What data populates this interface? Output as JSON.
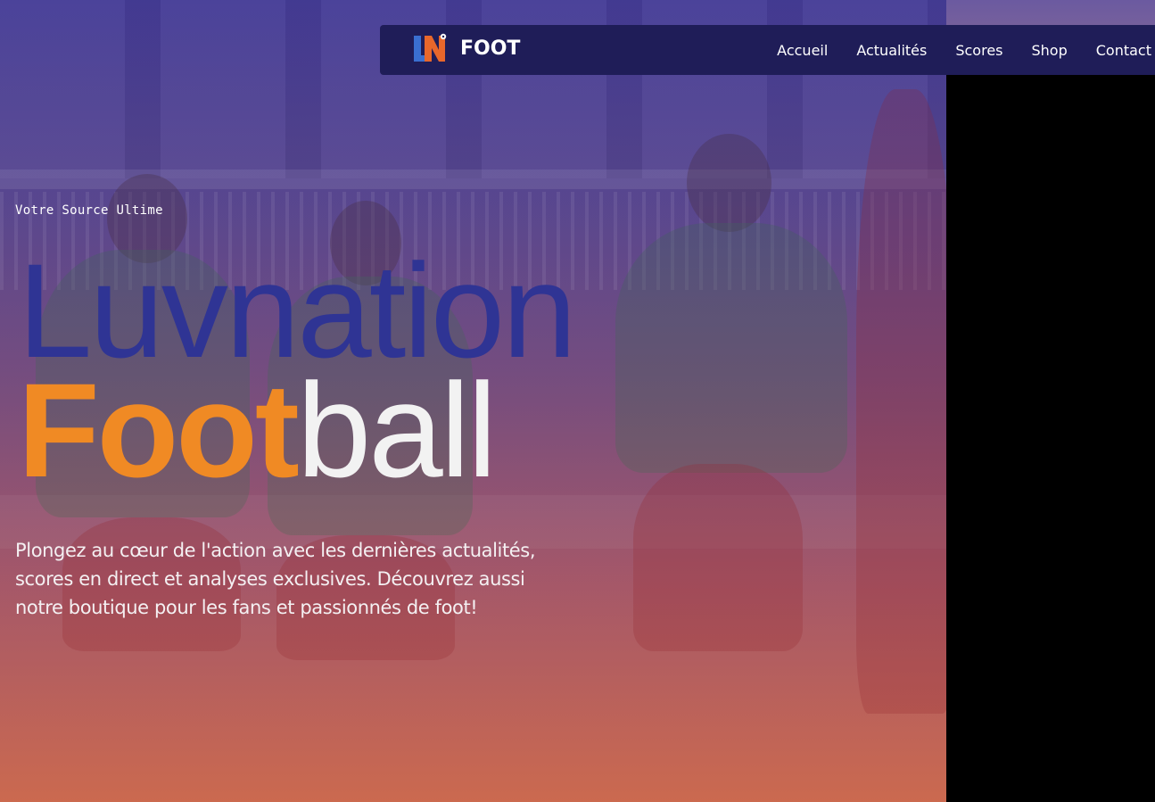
{
  "brand": {
    "name": "FOOT",
    "logo_text": "LN",
    "logo_icon": "ln-foot-logo-icon"
  },
  "nav": {
    "items": [
      {
        "label": "Accueil"
      },
      {
        "label": "Actualités"
      },
      {
        "label": "Scores"
      },
      {
        "label": "Shop"
      },
      {
        "label": "Contact"
      }
    ]
  },
  "hero": {
    "eyebrow": "Votre Source Ultime",
    "title_line1": "Luvnation",
    "title_line2_accent": "Foot",
    "title_line2_rest": "ball",
    "lead": "Plongez au cœur de l'action avec les dernières actualités, scores en direct et analyses exclusives. Découvrez aussi notre boutique pour les fans et passionnés de foot!"
  },
  "colors": {
    "navbar_bg": "#1f1d58",
    "title_blue": "#2f3494",
    "accent_orange": "#f08a24",
    "text_white": "#ffffff"
  }
}
